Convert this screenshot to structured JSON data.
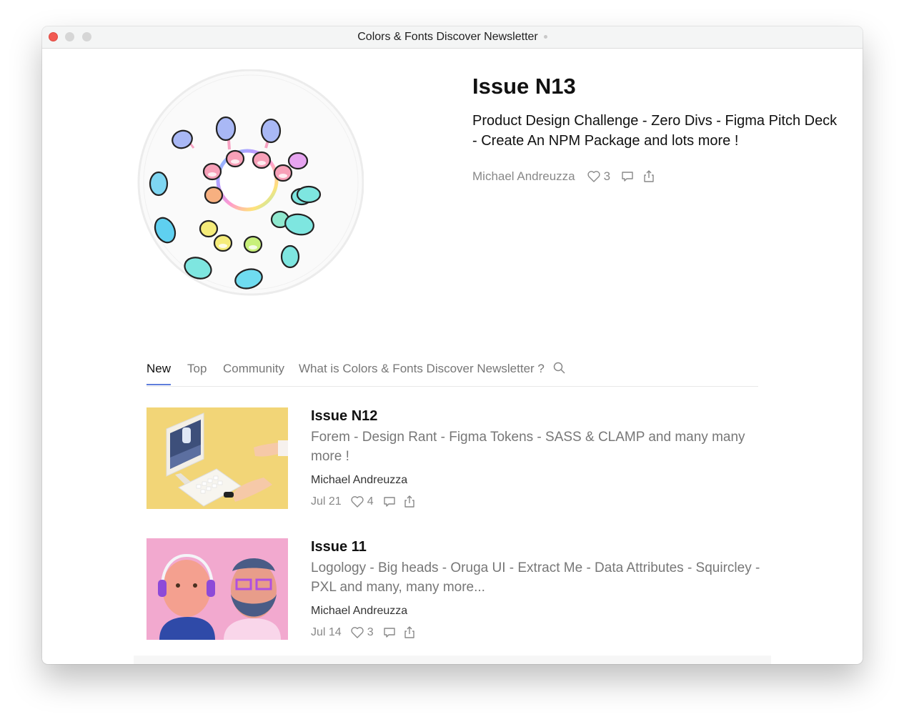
{
  "window": {
    "title": "Colors & Fonts Discover Newsletter"
  },
  "featured": {
    "title": "Issue N13",
    "description": "Product Design Challenge - Zero Divs - Figma Pitch Deck - Create An NPM Package and lots more !",
    "author": "Michael Andreuzza",
    "likes": "3",
    "icons": [
      "heart-icon",
      "comment-icon",
      "share-icon"
    ]
  },
  "tabs": {
    "items": [
      "New",
      "Top",
      "Community",
      "What is Colors & Fonts Discover Newsletter ?"
    ],
    "active": "New",
    "search_icon": "search-icon"
  },
  "posts": [
    {
      "title": "Issue N12",
      "description": "Forem - Design Rant - Figma Tokens - SASS & CLAMP and many many more !",
      "author": "Michael Andreuzza",
      "date": "Jul 21",
      "likes": "4"
    },
    {
      "title": "Issue 11",
      "description": "Logology - Big heads - Oruga UI - Extract Me - Data Attributes - Squircley - PXL and many, many more...",
      "author": "Michael Andreuzza",
      "date": "Jul 14",
      "likes": "3"
    }
  ],
  "colors": {
    "accent": "#5f7edb",
    "close": "#f25a52",
    "text": "#111111",
    "muted": "#777777"
  }
}
